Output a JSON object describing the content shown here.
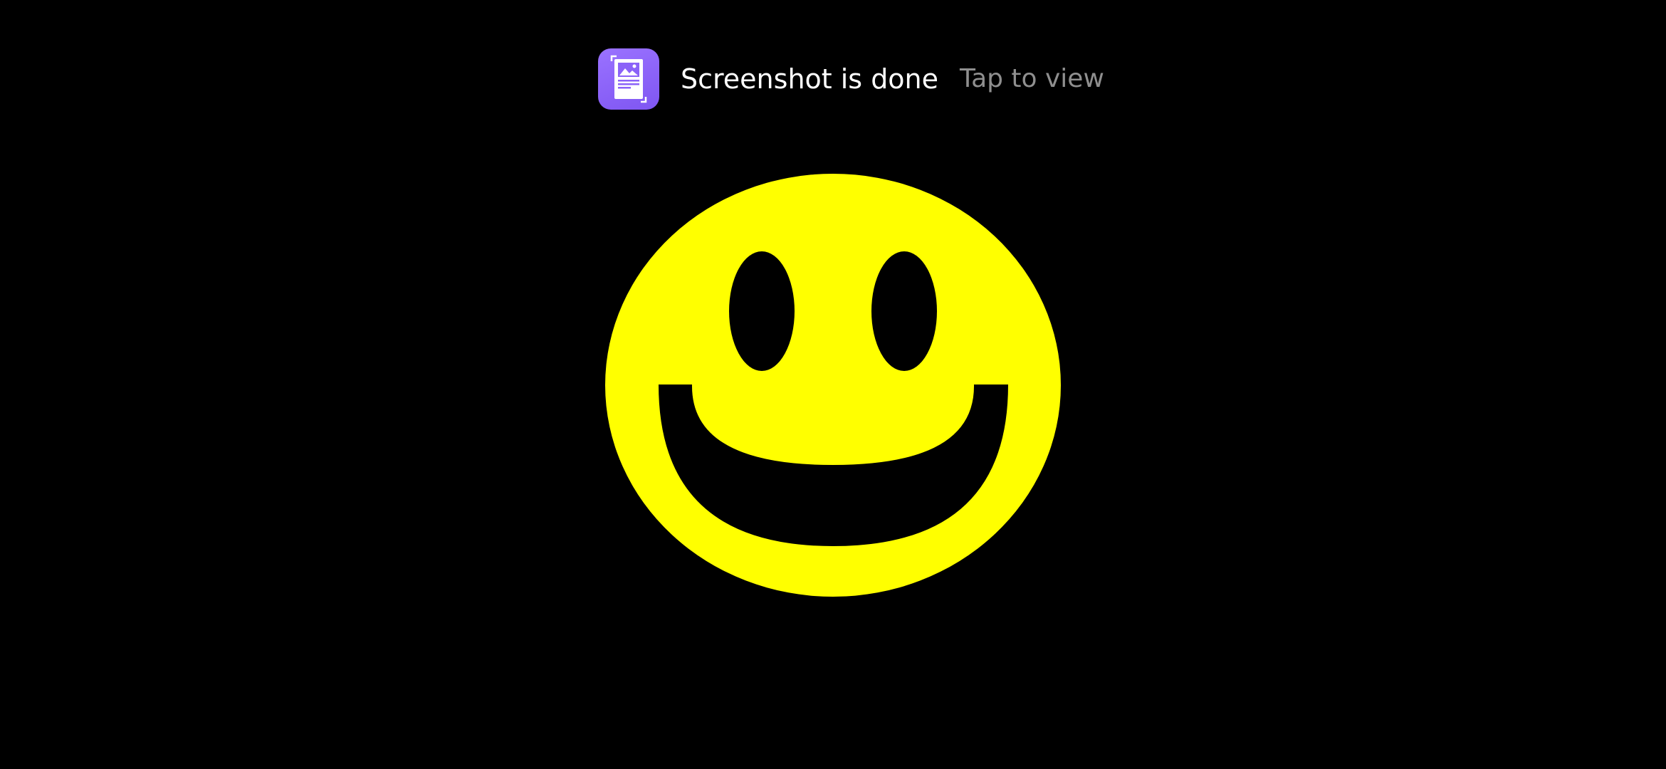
{
  "notification": {
    "app_icon": "screenshot-icon",
    "title": "Screenshot is done",
    "action": "Tap to view",
    "accent_color": "#8B63F8"
  },
  "content": {
    "image_icon": "smiley-face-icon",
    "face_color": "#FFFF00",
    "background_color": "#000000"
  }
}
